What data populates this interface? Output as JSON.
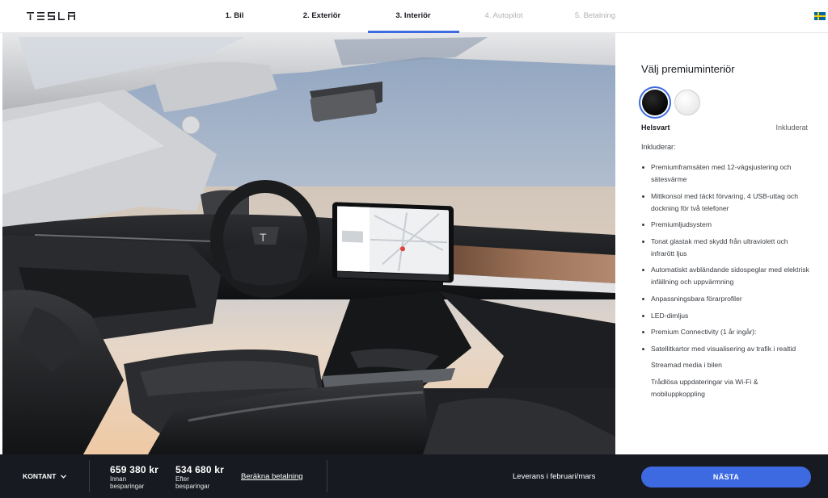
{
  "header": {
    "logo": "TESLA",
    "steps": [
      {
        "label": "1. Bil",
        "state": "done"
      },
      {
        "label": "2. Exteriör",
        "state": "done"
      },
      {
        "label": "3. Interiör",
        "state": "active"
      },
      {
        "label": "4. Autopilot",
        "state": "disabled"
      },
      {
        "label": "5. Betalning",
        "state": "disabled"
      }
    ],
    "flag_icon": "sweden-flag-icon",
    "accent_color": "#3e6ae1"
  },
  "panel": {
    "title": "Välj premiuminteriör",
    "swatches": [
      {
        "name": "black",
        "selected": true
      },
      {
        "name": "white",
        "selected": false
      }
    ],
    "selected_name": "Helsvart",
    "selected_price": "Inkluderat",
    "includes_label": "Inkluderar:",
    "features": [
      {
        "text": "Premiumframsäten med 12-vägsjustering och sätesvärme",
        "bullet": true
      },
      {
        "text": "Mittkonsol med täckt förvaring, 4 USB-uttag och dockning för två telefoner",
        "bullet": true
      },
      {
        "text": "Premiumljudsystem",
        "bullet": true
      },
      {
        "text": "Tonat glastak med skydd från ultraviolett och infrarött ljus",
        "bullet": true
      },
      {
        "text": "Automatiskt avbländande sidospeglar med elektrisk infällning och uppvärmning",
        "bullet": true
      },
      {
        "text": "Anpassningsbara förarprofiler",
        "bullet": true
      },
      {
        "text": "LED-dimljus",
        "bullet": true
      },
      {
        "text": "Premium Connectivity (1 år ingår):",
        "bullet": true
      },
      {
        "text": "Satellitkartor med visualisering av trafik i realtid",
        "bullet": true
      },
      {
        "text": "Streamad media i bilen",
        "bullet": false
      },
      {
        "text": "Trådlösa uppdateringar via Wi-Fi & mobiluppkoppling",
        "bullet": false
      }
    ]
  },
  "footer": {
    "payment_type": "KONTANT",
    "price_before": "659 380 kr",
    "price_before_label": "Innan besparingar",
    "price_after": "534 680 kr",
    "price_after_label": "Efter besparingar",
    "calc_link": "Beräkna betalning",
    "delivery": "Leverans i februari/mars",
    "next_button": "NÄSTA"
  }
}
